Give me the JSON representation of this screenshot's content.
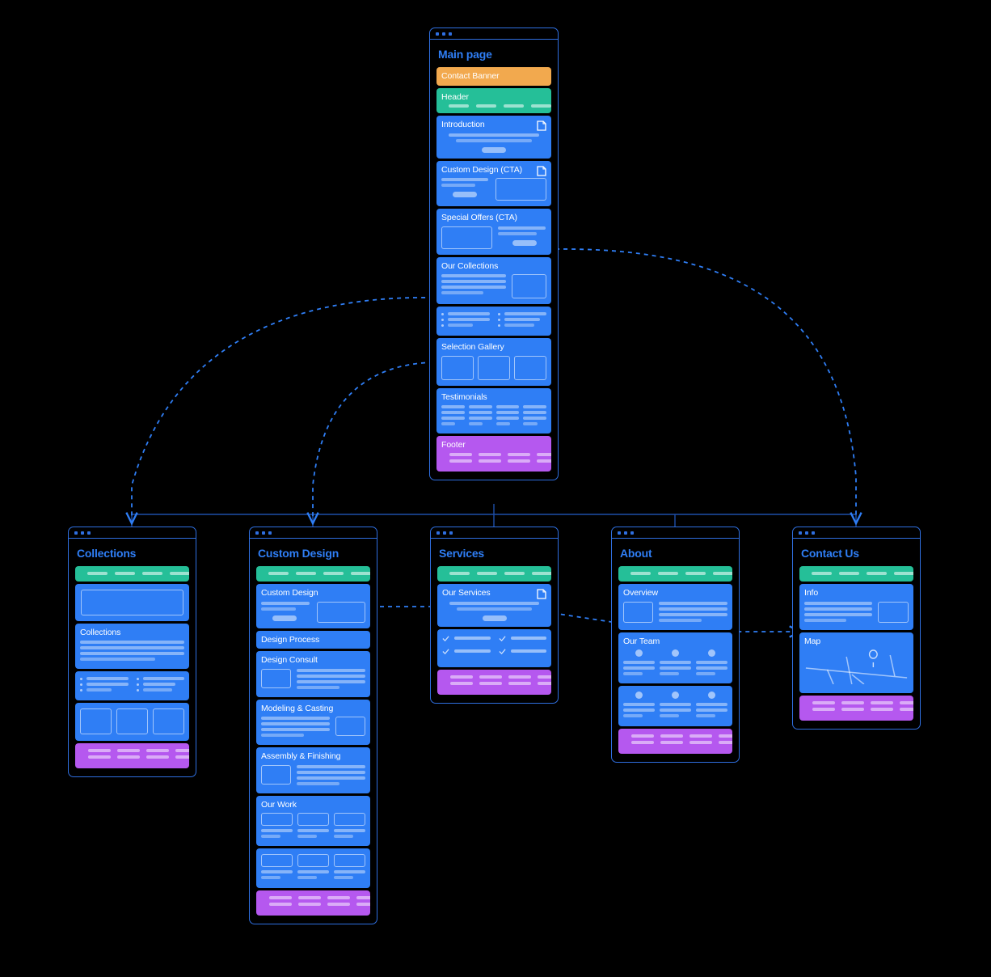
{
  "diagram": {
    "type": "sitemap",
    "background": "#000000",
    "colors": {
      "accent_blue": "#2f7ef5",
      "frame_blue": "#2f6fe0",
      "section_blue": "#2f7ef5",
      "section_teal": "#25bf98",
      "section_orange": "#f2a94e",
      "section_purple": "#b558ef",
      "connector_solid": "#1e4fa8",
      "connector_dashed": "#2f7ef5"
    }
  },
  "main_page": {
    "title": "Main page",
    "window_dots": 3,
    "sections": [
      {
        "label": "Contact Banner",
        "color": "orange",
        "kind": "banner"
      },
      {
        "label": "Header",
        "color": "teal",
        "kind": "nav"
      },
      {
        "label": "Introduction",
        "color": "blue",
        "kind": "text-cta",
        "icon": "document-icon"
      },
      {
        "label": "Custom Design (CTA)",
        "color": "blue",
        "kind": "text-left-image-right",
        "icon": "document-icon"
      },
      {
        "label": "Special Offers (CTA)",
        "color": "blue",
        "kind": "image-left-text-right"
      },
      {
        "label": "Our Collections",
        "color": "blue",
        "kind": "text-left-image-right"
      },
      {
        "label": "",
        "color": "blue",
        "kind": "bullet-columns"
      },
      {
        "label": "Selection Gallery",
        "color": "blue",
        "kind": "three-tiles"
      },
      {
        "label": "Testimonials",
        "color": "blue",
        "kind": "four-quotes"
      },
      {
        "label": "Footer",
        "color": "purple",
        "kind": "footer"
      }
    ]
  },
  "child_pages": [
    {
      "title": "Collections",
      "window_dots": 3,
      "sections": [
        {
          "label": "",
          "color": "teal",
          "kind": "nav"
        },
        {
          "label": "",
          "color": "blue",
          "kind": "hero-box"
        },
        {
          "label": "Collections",
          "color": "blue",
          "kind": "text-block"
        },
        {
          "label": "",
          "color": "blue",
          "kind": "bullet-columns"
        },
        {
          "label": "",
          "color": "blue",
          "kind": "three-tiles"
        },
        {
          "label": "",
          "color": "purple",
          "kind": "footer"
        }
      ]
    },
    {
      "title": "Custom Design",
      "window_dots": 3,
      "sections": [
        {
          "label": "",
          "color": "teal",
          "kind": "nav"
        },
        {
          "label": "Custom Design",
          "color": "blue",
          "kind": "text-left-image-right"
        },
        {
          "label": "Design Process",
          "color": "blue",
          "kind": "title-only"
        },
        {
          "label": "Design Consult",
          "color": "blue",
          "kind": "image-left-text-right-sm"
        },
        {
          "label": "Modeling & Casting",
          "color": "blue",
          "kind": "text-left-image-right-sm"
        },
        {
          "label": "Assembly & Finishing",
          "color": "blue",
          "kind": "image-left-text-right-sm"
        },
        {
          "label": "Our Work",
          "color": "blue",
          "kind": "three-cards"
        },
        {
          "label": "",
          "color": "blue",
          "kind": "three-cards"
        },
        {
          "label": "",
          "color": "purple",
          "kind": "footer"
        }
      ]
    },
    {
      "title": "Services",
      "window_dots": 3,
      "sections": [
        {
          "label": "",
          "color": "teal",
          "kind": "nav"
        },
        {
          "label": "Our Services",
          "color": "blue",
          "kind": "text-cta",
          "icon": "document-icon"
        },
        {
          "label": "",
          "color": "blue",
          "kind": "checklist"
        },
        {
          "label": "",
          "color": "purple",
          "kind": "footer"
        }
      ]
    },
    {
      "title": "About",
      "window_dots": 3,
      "sections": [
        {
          "label": "",
          "color": "teal",
          "kind": "nav"
        },
        {
          "label": "Overview",
          "color": "blue",
          "kind": "image-left-text-right-sm"
        },
        {
          "label": "Our Team",
          "color": "blue",
          "kind": "three-people"
        },
        {
          "label": "",
          "color": "blue",
          "kind": "three-people"
        },
        {
          "label": "",
          "color": "purple",
          "kind": "footer"
        }
      ]
    },
    {
      "title": "Contact Us",
      "window_dots": 3,
      "sections": [
        {
          "label": "",
          "color": "teal",
          "kind": "nav"
        },
        {
          "label": "Info",
          "color": "blue",
          "kind": "text-left-image-right"
        },
        {
          "label": "Map",
          "color": "blue",
          "kind": "map"
        },
        {
          "label": "",
          "color": "purple",
          "kind": "footer"
        }
      ]
    }
  ],
  "connections": [
    {
      "from": "Our Collections",
      "to": "Collections",
      "style": "dashed-curve"
    },
    {
      "from": "Selection Gallery",
      "to": "Custom Design",
      "style": "dashed-curve"
    },
    {
      "from": "Special Offers (CTA)",
      "to": "Contact Us",
      "style": "dashed-curve"
    },
    {
      "from": "Custom Design",
      "to": "Our Services",
      "style": "dashed-straight"
    },
    {
      "from": "Our Services",
      "to": "Info",
      "style": "dashed-straight"
    },
    {
      "from": "Main page",
      "to": "all-children",
      "style": "solid-tree"
    }
  ]
}
